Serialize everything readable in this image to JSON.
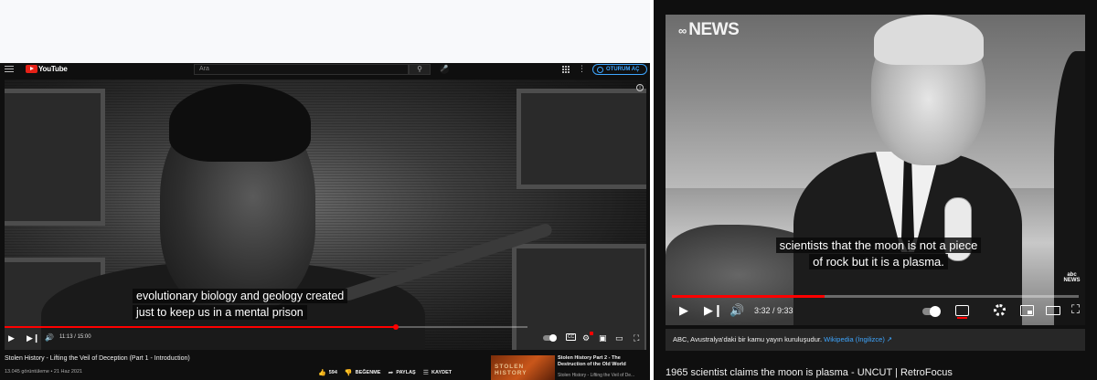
{
  "left": {
    "header": {
      "logo_text": "YouTube",
      "search_placeholder": "Ara",
      "signin_label": "OTURUM AÇ"
    },
    "video": {
      "caption_line1": "evolutionary biology and geology created",
      "caption_line2": "just to keep us in a mental prison",
      "time_display": "11:13 / 15:00",
      "progress": 0.748
    },
    "info": {
      "title": "Stolen History - Lifting the Veil of Deception (Part 1 - Introduction)",
      "meta": "13.045 görüntüleme • 21 Haz 2021",
      "like_count": "594",
      "dislike_label": "BEĞENME",
      "share_label": "PAYLAŞ",
      "save_label": "KAYDET"
    },
    "next_video": {
      "thumb_text": "STOLEN HISTORY",
      "title": "Stolen History Part 2 - The Destruction of the Old World",
      "channel": "Stolen History - Lifting the Veil of De..."
    }
  },
  "right": {
    "video": {
      "watermark": "NEWS",
      "corner_badge": "abc NEWS",
      "caption_line1": "scientists that the moon is not a piece",
      "caption_line2": "of rock but it is a plasma.",
      "time_display": "3:32 / 9:33",
      "progress": 0.376
    },
    "info_panel": {
      "text": "ABC, Avustralya'daki bir kamu yayın kuruluşudur.",
      "link_text": "Wikipedia (İngilizce)"
    },
    "title": "1965 scientist claims the moon is plasma - UNCUT | RetroFocus"
  },
  "colors": {
    "accent_red": "#ff0000",
    "link_blue": "#3ea6ff",
    "dark_bg": "#0f0f0f"
  },
  "icons": {
    "play": "play-icon",
    "next": "next-icon",
    "volume": "volume-icon",
    "settings": "gear-icon",
    "miniplayer": "miniplayer-icon",
    "theater": "theater-icon",
    "fullscreen": "fullscreen-icon"
  }
}
